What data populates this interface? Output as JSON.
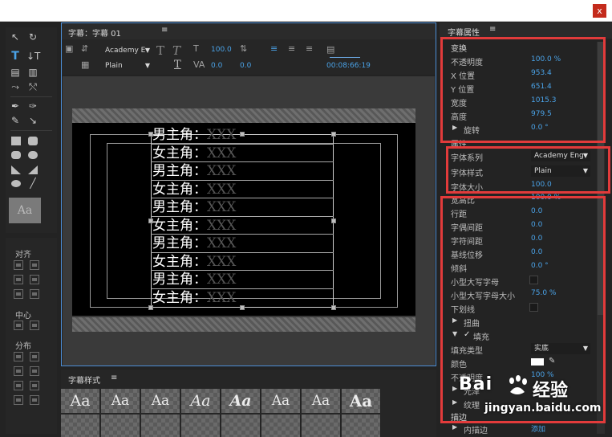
{
  "window": {
    "close_glyph": "x"
  },
  "main_panel": {
    "tab_title": "字幕：字幕 01",
    "tab_menu": "≡",
    "font_family_value": "Academy E",
    "font_style_value": "Plain",
    "font_size_value": "100.0",
    "kerning_value": "0.0",
    "tracking_value": "0.0",
    "timecode": "00:08:66:19"
  },
  "subtitles": [
    {
      "role": "男主角：",
      "placeholder": "XXX"
    },
    {
      "role": "女主角：",
      "placeholder": "XXX"
    },
    {
      "role": "男主角：",
      "placeholder": "XXX"
    },
    {
      "role": "女主角：",
      "placeholder": "XXX"
    },
    {
      "role": "男主角：",
      "placeholder": "XXX"
    },
    {
      "role": "女主角：",
      "placeholder": "XXX"
    },
    {
      "role": "男主角：",
      "placeholder": "XXX"
    },
    {
      "role": "女主角：",
      "placeholder": "XXX"
    },
    {
      "role": "男主角：",
      "placeholder": "XXX"
    },
    {
      "role": "女主角：",
      "placeholder": "XXX"
    }
  ],
  "tools": {
    "preview_label": "Aa"
  },
  "align_panel": {
    "align_label": "对齐",
    "center_label": "中心",
    "distribute_label": "分布"
  },
  "styles_panel": {
    "title": "字幕样式",
    "menu": "≡",
    "swatch_label": "Aa"
  },
  "properties": {
    "title": "字幕属性",
    "menu": "≡",
    "transform_section": "变换",
    "opacity_label": "不透明度",
    "opacity_value": "100.0 %",
    "x_label": "X 位置",
    "x_value": "953.4",
    "y_label": "Y 位置",
    "y_value": "651.4",
    "width_label": "宽度",
    "width_value": "1015.3",
    "height_label": "高度",
    "height_value": "979.5",
    "rotation_label": "旋转",
    "rotation_value": "0.0 °",
    "attributes_section": "属性",
    "font_family_label": "字体系列",
    "font_family_value": "Academy Eng",
    "font_style_label": "字体样式",
    "font_style_value": "Plain",
    "font_size_label": "字体大小",
    "font_size_value": "100.0",
    "aspect_label": "宽高比",
    "aspect_value": "100.0 %",
    "leading_label": "行距",
    "leading_value": "0.0",
    "kerning_label": "字偶间距",
    "kerning_value": "0.0",
    "tracking_label": "字符间距",
    "tracking_value": "0.0",
    "baseline_label": "基线位移",
    "baseline_value": "0.0",
    "slant_label": "倾斜",
    "slant_value": "0.0 °",
    "small_caps_label": "小型大写字母",
    "small_caps_size_label": "小型大写字母大小",
    "small_caps_size_value": "75.0 %",
    "underline_label": "下划线",
    "distort_label": "扭曲",
    "fill_label": "填充",
    "fill_type_label": "填充类型",
    "fill_type_value": "实底",
    "color_label": "颜色",
    "fill_opacity_label": "不透明度",
    "fill_opacity_value": "100 %",
    "sheen_label": "光泽",
    "texture_label": "纹理",
    "stroke_section": "描边",
    "inner_stroke_label": "内描边",
    "inner_stroke_value": "添加"
  },
  "watermark": {
    "logo": "Bai",
    "text": "经验",
    "url": "jingyan.baidu.com"
  },
  "colors": {
    "accent_blue": "#4aa3e8",
    "highlight_red": "#e23b3b",
    "panel_bg": "#232323"
  }
}
